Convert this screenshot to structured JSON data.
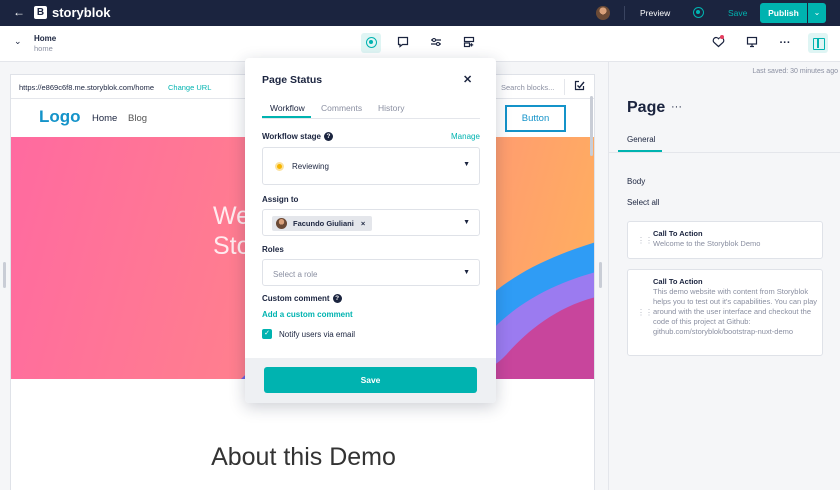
{
  "topbar": {
    "back_icon": "arrow-left-icon",
    "brand": "storyblok",
    "brand_mark": "B",
    "preview": "Preview",
    "save": "Save",
    "publish": "Publish"
  },
  "subbar": {
    "story_title": "Home",
    "story_slug": "home"
  },
  "preview": {
    "url": "https://e869c6f8.me.storyblok.com/home",
    "change_url": "Change URL",
    "search_placeholder": "Search blocks...",
    "site_logo": "Logo",
    "nav_home": "Home",
    "nav_blog": "Blog",
    "nav_button": "Button",
    "hero_text": "We\nSto",
    "about_title": "About this Demo",
    "hero_colors": [
      "#ff6aa0",
      "#ff9d6f",
      "#ffb25c",
      "#2f9cf5",
      "#9b7bf0",
      "#c8459c"
    ]
  },
  "right_panel": {
    "last_saved": "Last saved: 30 minutes ago",
    "title": "Page",
    "tab": "General",
    "body_label": "Body",
    "select_all": "Select all",
    "cards": [
      {
        "title": "Call To Action",
        "description": "Welcome to the Storyblok Demo"
      },
      {
        "title": "Call To Action",
        "description": "This demo website with content from Storyblok helps you to test out it's capabilities. You can play around with the user interface and checkout the code of this project at Github: github.com/storyblok/bootstrap-nuxt-demo"
      }
    ]
  },
  "modal": {
    "title": "Page Status",
    "tabs": [
      "Workflow",
      "Comments",
      "History"
    ],
    "workflow_stage_label": "Workflow stage",
    "manage": "Manage",
    "stage_value": "Reviewing",
    "assign_label": "Assign to",
    "assignee": "Facundo Giuliani",
    "roles_label": "Roles",
    "roles_placeholder": "Select a role",
    "custom_comment_label": "Custom comment",
    "add_comment": "Add a custom comment",
    "notify_label": "Notify users via email",
    "notify_checked": true,
    "save": "Save"
  },
  "colors": {
    "accent": "#00b3b0",
    "dark": "#1b243f",
    "site_blue": "#1493c9",
    "reviewing": "#f7b500"
  }
}
